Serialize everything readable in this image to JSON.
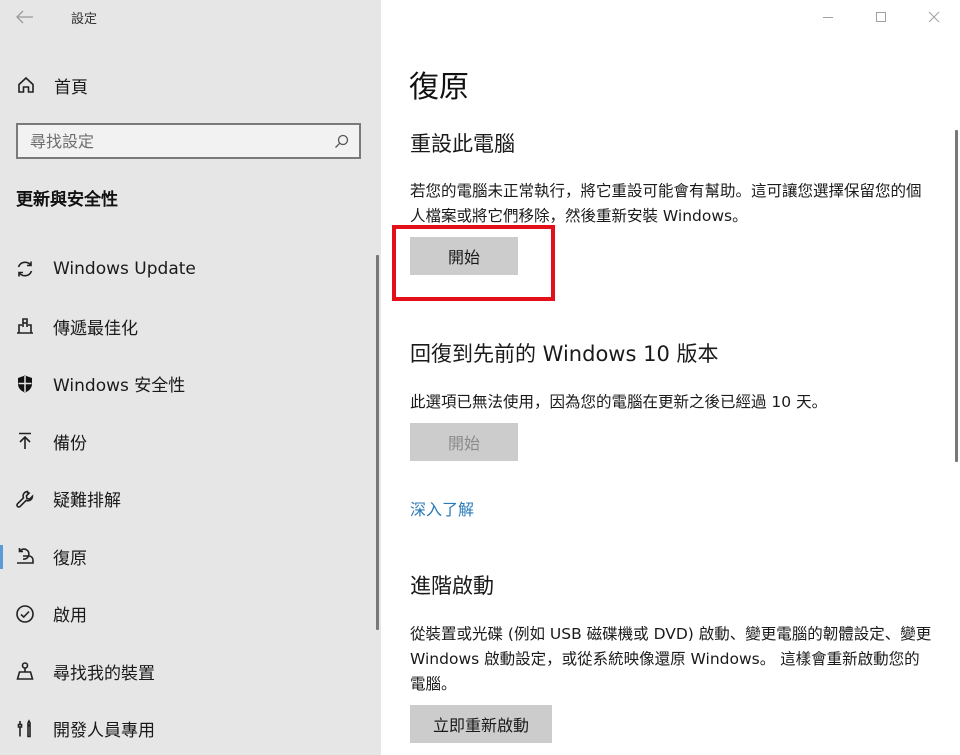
{
  "window": {
    "app_title": "設定",
    "back_icon": "arrow-left-icon",
    "controls": {
      "minimize_icon": "minimize-icon",
      "maximize_icon": "maximize-icon",
      "close_icon": "close-icon"
    }
  },
  "sidebar": {
    "home": {
      "label": "首頁",
      "icon": "home-icon"
    },
    "search": {
      "placeholder": "尋找設定",
      "value": "",
      "icon": "search-icon"
    },
    "section_title": "更新與安全性",
    "items": [
      {
        "label": "Windows Update",
        "icon": "sync-icon",
        "selected": false
      },
      {
        "label": "傳遞最佳化",
        "icon": "delivery-optimization-icon",
        "selected": false
      },
      {
        "label": "Windows 安全性",
        "icon": "shield-icon",
        "selected": false
      },
      {
        "label": "備份",
        "icon": "backup-arrow-up-icon",
        "selected": false
      },
      {
        "label": "疑難排解",
        "icon": "wrench-icon",
        "selected": false
      },
      {
        "label": "復原",
        "icon": "recovery-icon",
        "selected": true
      },
      {
        "label": "啟用",
        "icon": "check-circle-icon",
        "selected": false
      },
      {
        "label": "尋找我的裝置",
        "icon": "find-device-icon",
        "selected": false
      },
      {
        "label": "開發人員專用",
        "icon": "developer-tools-icon",
        "selected": false
      }
    ]
  },
  "main": {
    "title": "復原",
    "sections": {
      "reset": {
        "heading": "重設此電腦",
        "description": "若您的電腦未正常執行，將它重設可能會有幫助。這可讓您選擇保留您的個人檔案或將它們移除，然後重新安裝 Windows。",
        "button_label": "開始",
        "highlighted": true
      },
      "go_back": {
        "heading": "回復到先前的 Windows 10 版本",
        "description": "此選項已無法使用，因為您的電腦在更新之後已經過 10 天。",
        "button_label": "開始",
        "button_disabled": true,
        "link_label": "深入了解"
      },
      "advanced": {
        "heading": "進階啟動",
        "description": "從裝置或光碟 (例如 USB 磁碟機或 DVD) 啟動、變更電腦的韌體設定、變更 Windows 啟動設定，或從系統映像還原 Windows。 這樣會重新啟動您的電腦。",
        "button_label": "立即重新啟動"
      }
    }
  },
  "colors": {
    "sidebar_bg": "#e6e6e6",
    "button_bg": "#cccccc",
    "link": "#2a7ab8",
    "highlight_border": "#e3101a",
    "selected_indicator": "#5a9bd5"
  }
}
